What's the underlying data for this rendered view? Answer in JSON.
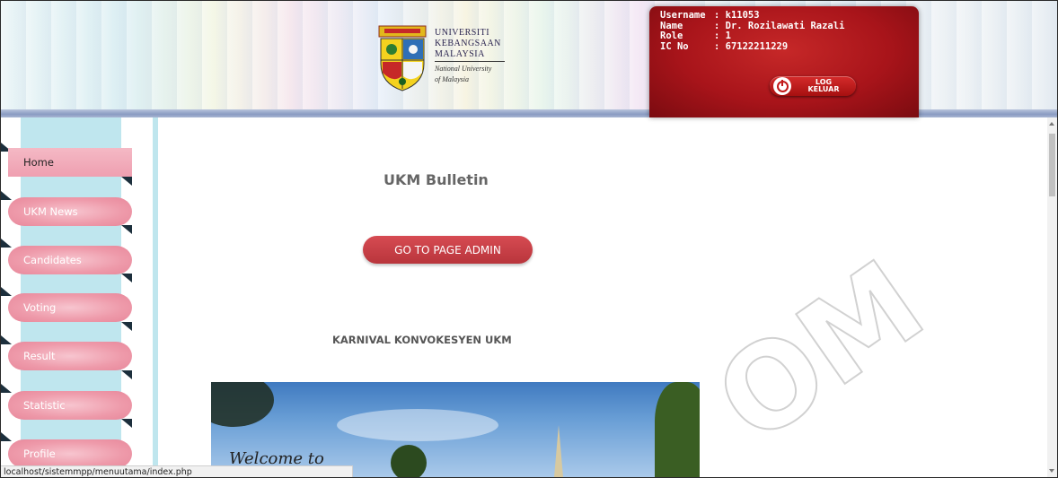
{
  "header": {
    "logo": {
      "line1": "UNIVERSITI",
      "line2": "KEBANGSAAN",
      "line3": "MALAYSIA",
      "sub1": "National University",
      "sub2": "of Malaysia"
    },
    "user": {
      "username_label": "Username",
      "username_value": ": k11053",
      "name_label": "Name",
      "name_value": ": Dr. Rozilawati Razali",
      "role_label": "Role",
      "role_value": ": 1",
      "ic_label": "IC No",
      "ic_value": ": 67122211229"
    },
    "logout": {
      "line1": "LOG",
      "line2": "KELUAR"
    }
  },
  "sidebar": {
    "items": [
      {
        "label": "Home"
      },
      {
        "label": "UKM News"
      },
      {
        "label": "Candidates"
      },
      {
        "label": "Voting"
      },
      {
        "label": "Result"
      },
      {
        "label": "Statistic"
      },
      {
        "label": "Profile"
      }
    ]
  },
  "main": {
    "title": "UKM Bulletin",
    "admin_button": "GO TO PAGE ADMIN",
    "section_title": "KARNIVAL KONVOKESYEN UKM",
    "photo_caption": "Welcome to"
  },
  "statusbar": {
    "url": "localhost/sistemmpp/menuutama/index.php"
  },
  "watermark": "OM",
  "colors": {
    "header_red": "#a8141a",
    "nav_pink": "#ee9aaa",
    "sidebar_blue": "#bfe6ee",
    "button_red": "#c9414a"
  }
}
